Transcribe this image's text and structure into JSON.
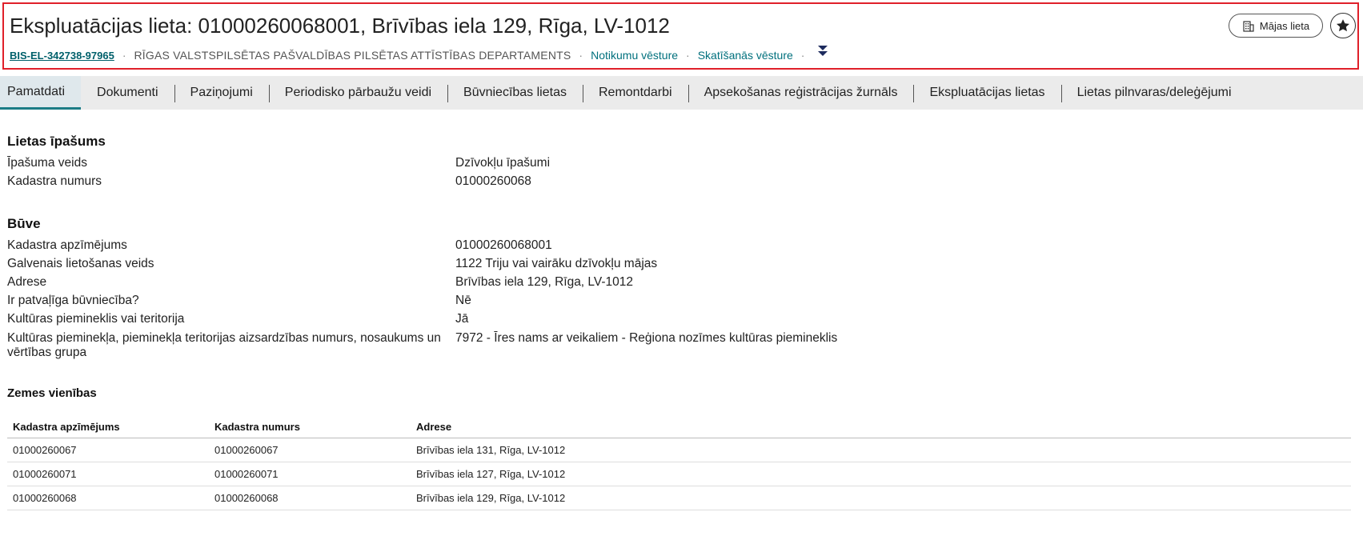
{
  "header": {
    "title": "Ekspluatācijas lieta: 01000260068001, Brīvības iela 129, Rīga, LV-1012",
    "case_id": "BIS-EL-342738-97965",
    "department": "RĪGAS VALSTSPILSĒTAS PAŠVALDĪBAS PILSĒTAS ATTĪSTĪBAS DEPARTAMENTS",
    "event_history_link": "Notikumu vēsture",
    "view_history_link": "Skatīšanās vēsture",
    "house_button_label": "Mājas lieta",
    "separator": "·",
    "highlight_border_color": "#e0202a"
  },
  "tabs": [
    {
      "label": "Pamatdati",
      "active": true
    },
    {
      "label": "Dokumenti"
    },
    {
      "label": "Paziņojumi"
    },
    {
      "label": "Periodisko pārbaužu veidi"
    },
    {
      "label": "Būvniecības lietas"
    },
    {
      "label": "Remontdarbi"
    },
    {
      "label": "Apsekošanas reģistrācijas žurnāls"
    },
    {
      "label": "Ekspluatācijas lietas"
    },
    {
      "label": "Lietas pilnvaras/deleģējumi"
    }
  ],
  "property": {
    "title": "Lietas īpašums",
    "rows": [
      {
        "k": "Īpašuma veids",
        "v": "Dzīvokļu īpašumi"
      },
      {
        "k": "Kadastra numurs",
        "v": "01000260068"
      }
    ]
  },
  "building": {
    "title": "Būve",
    "rows": [
      {
        "k": "Kadastra apzīmējums",
        "v": "01000260068001"
      },
      {
        "k": "Galvenais lietošanas veids",
        "v": "1122 Triju vai vairāku dzīvokļu mājas"
      },
      {
        "k": "Adrese",
        "v": "Brīvības iela 129, Rīga, LV-1012"
      },
      {
        "k": "Ir patvaļīga būvniecība?",
        "v": "Nē"
      },
      {
        "k": "Kultūras piemineklis vai teritorija",
        "v": "Jā"
      },
      {
        "k": "Kultūras pieminekļa, pieminekļa teritorijas aizsardzības numurs, nosaukums un vērtības grupa",
        "v": "7972 - Īres nams ar veikaliem - Reģiona nozīmes kultūras piemineklis"
      }
    ]
  },
  "land": {
    "title": "Zemes vienības",
    "columns": [
      "Kadastra apzīmējums",
      "Kadastra numurs",
      "Adrese"
    ],
    "rows": [
      [
        "01000260067",
        "01000260067",
        "Brīvības iela 131, Rīga, LV-1012"
      ],
      [
        "01000260071",
        "01000260071",
        "Brīvības iela 127, Rīga, LV-1012"
      ],
      [
        "01000260068",
        "01000260068",
        "Brīvības iela 129, Rīga, LV-1012"
      ]
    ]
  }
}
